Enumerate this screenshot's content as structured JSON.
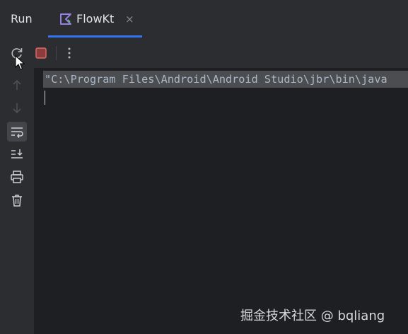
{
  "header": {
    "tool_window_title": "Run",
    "tabs": [
      {
        "label": "FlowKt",
        "icon": "kotlin-file-icon",
        "active": true,
        "close_glyph": "×"
      }
    ]
  },
  "toolbar": {
    "buttons": [
      {
        "name": "rerun",
        "icon": "rerun-icon"
      },
      {
        "name": "stop",
        "icon": "stop-icon",
        "color": "#c75450"
      },
      {
        "name": "more",
        "icon": "more-vertical-icon"
      }
    ]
  },
  "sidebar": {
    "buttons": [
      {
        "name": "up-stack-trace",
        "icon": "arrow-up-icon",
        "enabled": false
      },
      {
        "name": "down-stack-trace",
        "icon": "arrow-down-icon",
        "enabled": false
      },
      {
        "name": "soft-wrap",
        "icon": "soft-wrap-icon",
        "active": true
      },
      {
        "name": "scroll-to-end",
        "icon": "scroll-to-end-icon"
      },
      {
        "name": "print",
        "icon": "print-icon"
      },
      {
        "name": "clear-all",
        "icon": "trash-icon"
      }
    ]
  },
  "console": {
    "lines": [
      "\"C:\\Program Files\\Android\\Android Studio\\jbr\\bin\\java"
    ]
  },
  "watermark": "掘金技术社区 @ bqliang",
  "colors": {
    "background": "#1e1f22",
    "panel": "#2b2d30",
    "accent": "#3574f0",
    "stop": "#c75450",
    "kotlin_icon": "#9a7ee8"
  }
}
